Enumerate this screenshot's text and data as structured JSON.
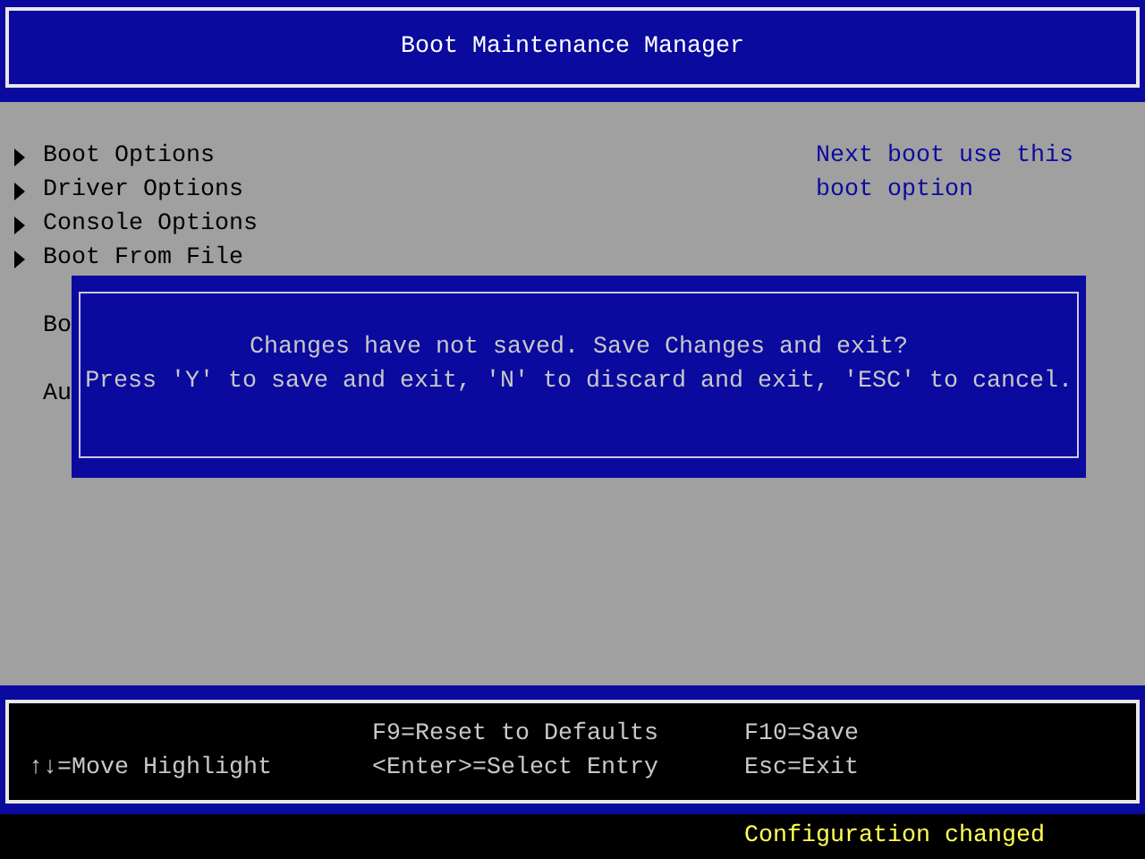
{
  "header": {
    "title": "Boot Maintenance Manager"
  },
  "menu": [
    {
      "kind": "submenu",
      "label": "Boot Options"
    },
    {
      "kind": "submenu",
      "label": "Driver Options"
    },
    {
      "kind": "submenu",
      "label": "Console Options"
    },
    {
      "kind": "submenu",
      "label": "Boot From File"
    },
    {
      "kind": "gap"
    },
    {
      "kind": "text",
      "label": "Bo"
    },
    {
      "kind": "gap"
    },
    {
      "kind": "text",
      "label": "Au"
    }
  ],
  "help": [
    "Next boot use this",
    "boot option"
  ],
  "dialog": {
    "lines": [
      "Changes have not saved. Save Changes and exit?",
      "Press 'Y' to save and exit, 'N' to discard and exit, 'ESC' to cancel."
    ]
  },
  "footer": {
    "columns": [
      {
        "lines": [
          "↑↓=Move Highlight"
        ]
      },
      {
        "lines": [
          "F9=Reset to Defaults",
          "<Enter>=Select Entry"
        ]
      },
      {
        "lines": [
          "F10=Save",
          "Esc=Exit"
        ]
      }
    ]
  },
  "status": "Configuration changed"
}
